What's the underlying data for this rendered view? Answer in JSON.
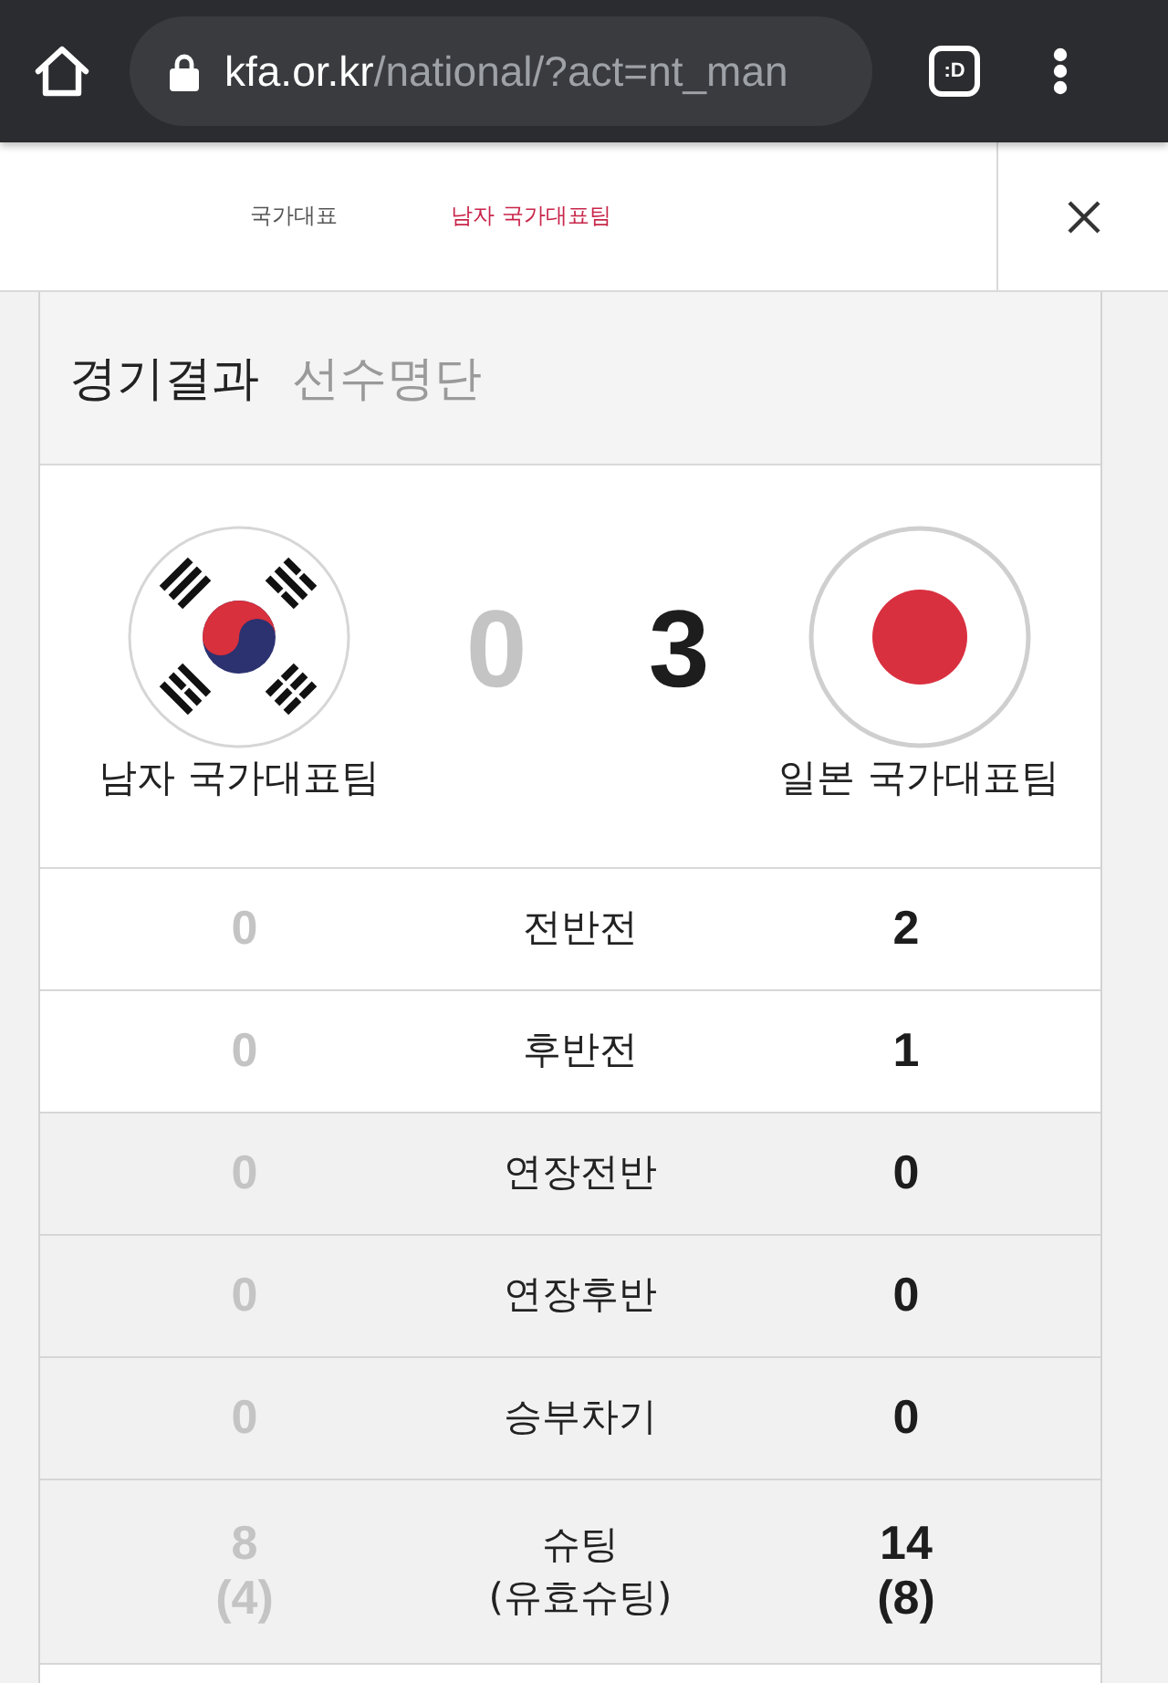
{
  "browser": {
    "url_host": "kfa.or.kr",
    "url_path": "/national/?act=nt_man",
    "tab_count": ":D"
  },
  "nav": {
    "links": [
      {
        "label": "국가대표",
        "selected": false
      },
      {
        "label": "남자 국가대표팀",
        "selected": true
      }
    ]
  },
  "card_tabs": [
    {
      "label": "경기결과",
      "selected": true
    },
    {
      "label": "선수명단",
      "selected": false
    }
  ],
  "match": {
    "home": {
      "name": "남자 국가대표팀",
      "score": "0",
      "winner": false,
      "kind": "korea"
    },
    "away": {
      "name": "일본 국가대표팀",
      "score": "3",
      "winner": true,
      "kind": "japan"
    }
  },
  "rows": [
    {
      "label": "전반전",
      "home": "0",
      "away": "2",
      "shaded": false
    },
    {
      "label": "후반전",
      "home": "0",
      "away": "1",
      "shaded": false
    },
    {
      "label": "연장전반",
      "home": "0",
      "away": "0",
      "shaded": true
    },
    {
      "label": "연장후반",
      "home": "0",
      "away": "0",
      "shaded": true
    },
    {
      "label": "승부차기",
      "home": "0",
      "away": "0",
      "shaded": true
    },
    {
      "label": "슈팅\n(유효슈팅)",
      "home": "8\n(4)",
      "away": "14\n(8)",
      "shaded": true
    }
  ]
}
